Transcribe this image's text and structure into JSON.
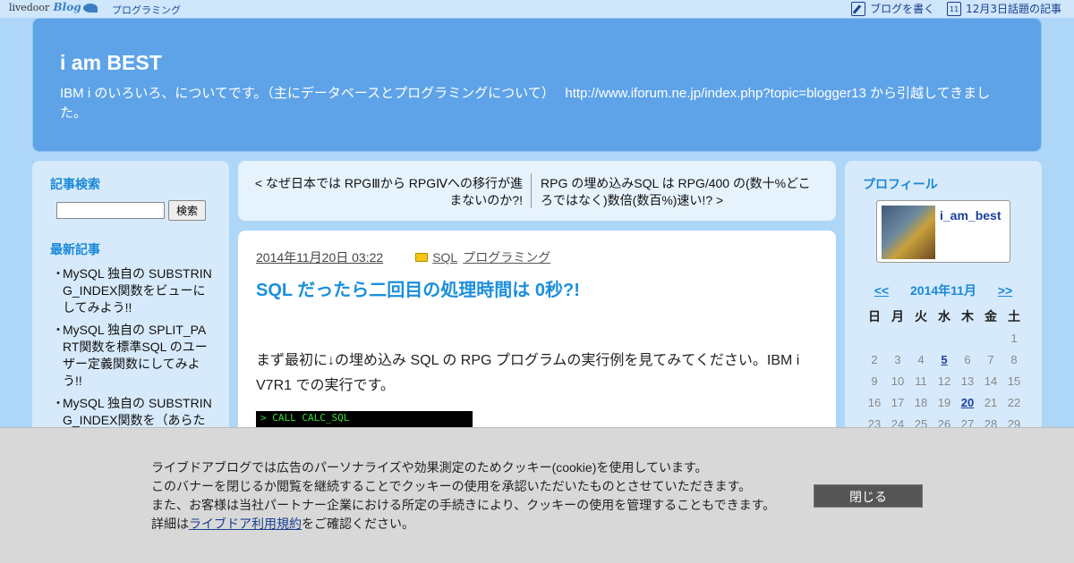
{
  "topbar": {
    "logo_livedoor": "livedoor",
    "logo_blog": "Blog",
    "category": "プログラミング",
    "write_blog": "ブログを書く",
    "topic_today": "12月3日話題の記事",
    "calendar_day": "11"
  },
  "header": {
    "title": "i am BEST",
    "description": "IBM i のいろいろ、についてです。（主にデータベースとプログラミングについて）　 http://www.iforum.ne.jp/index.php?topic=blogger13 から引越してきました。"
  },
  "left": {
    "search_heading": "記事検索",
    "search_button": "検索",
    "search_value": "",
    "recent_heading": "最新記事",
    "recent": [
      "MySQL 独自の SUBSTRING_INDEX関数をビューにしてみよう!!",
      "MySQL 独自の SPLIT_PART関数を標準SQL のユーザー定義関数にしてみよう!!",
      "MySQL 独自の SUBSTRING_INDEX関数を（あらた"
    ]
  },
  "nav": {
    "prev": "< なぜ日本では RPGⅢから RPGⅣへの移行が進まないのか?!",
    "next": "RPG の埋め込みSQL は RPG/400 の(数十%どころではなく)数倍(数百%)速い!? >"
  },
  "article": {
    "date": "2014年11月20日 03:22",
    "category_1": "SQL",
    "category_2": "プログラミング",
    "title": "SQL だったら二回目の処理時間は 0秒?!",
    "body": "まず最初に↓の埋め込み SQL の RPG プログラムの実行例を見てみてください。IBM i V7R1 での実行です。",
    "console_line": "> CALL CALC_SQL"
  },
  "right": {
    "profile_heading": "プロフィール",
    "profile_name": "i_am_best",
    "cal_prev": "<<",
    "cal_month": "2014年11月",
    "cal_next": ">>",
    "weekdays": [
      "日",
      "月",
      "火",
      "水",
      "木",
      "金",
      "土"
    ],
    "weeks": [
      [
        "",
        "",
        "",
        "",
        "",
        "",
        "1"
      ],
      [
        "2",
        "3",
        "4",
        "5",
        "6",
        "7",
        "8"
      ],
      [
        "9",
        "10",
        "11",
        "12",
        "13",
        "14",
        "15"
      ],
      [
        "16",
        "17",
        "18",
        "19",
        "20",
        "21",
        "22"
      ],
      [
        "23",
        "24",
        "25",
        "26",
        "27",
        "28",
        "29"
      ]
    ],
    "linked_days": [
      "5",
      "20"
    ]
  },
  "cookie": {
    "line1": "ライブドアブログでは広告のパーソナライズや効果測定のためクッキー(cookie)を使用しています。",
    "line2": "このバナーを閉じるか閲覧を継続することでクッキーの使用を承認いただいたものとさせていただきます。",
    "line3": "また、お客様は当社パートナー企業における所定の手続きにより、クッキーの使用を管理することもできます。",
    "line4_pre": "詳細は",
    "line4_link": "ライブドア利用規約",
    "line4_post": "をご確認ください。",
    "close": "閉じる"
  }
}
